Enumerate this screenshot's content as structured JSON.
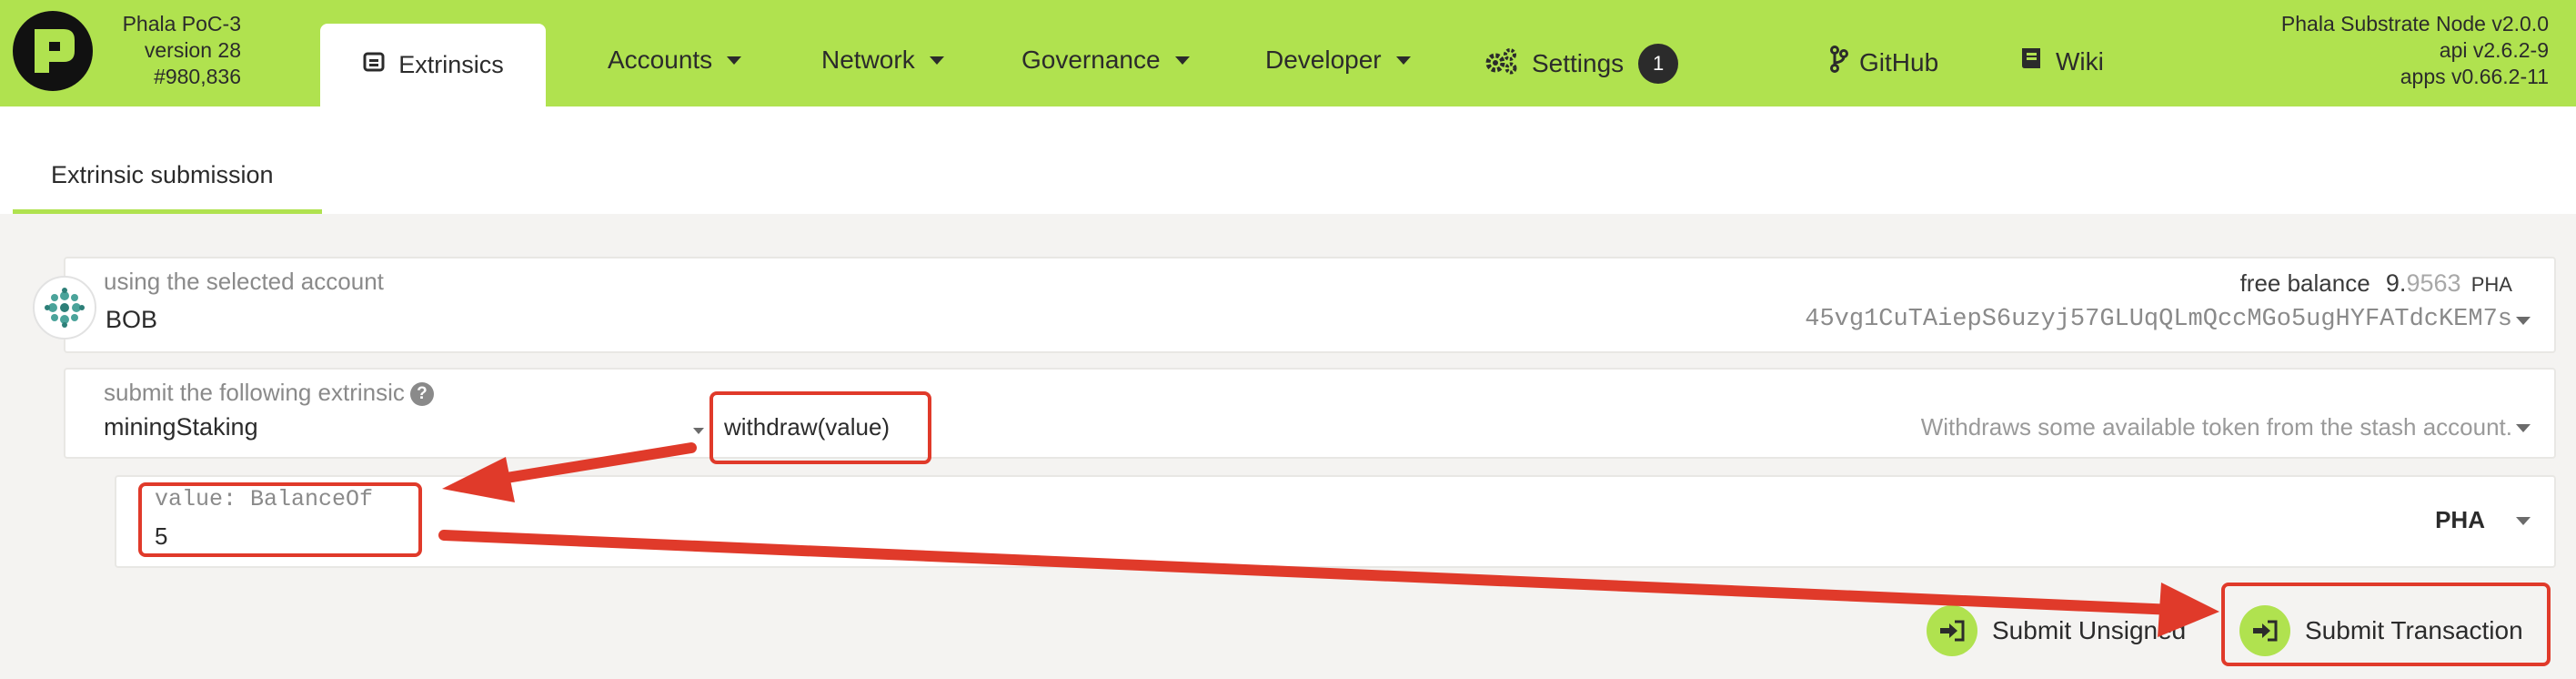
{
  "chain": {
    "name": "Phala PoC-3",
    "version": "version 28",
    "block": "#980,836"
  },
  "tabs": {
    "active": "Extrinsics"
  },
  "nav": [
    {
      "label": "Accounts"
    },
    {
      "label": "Network"
    },
    {
      "label": "Governance"
    },
    {
      "label": "Developer"
    },
    {
      "label": "Settings",
      "badge": "1"
    },
    {
      "label": "GitHub"
    },
    {
      "label": "Wiki"
    }
  ],
  "node": {
    "name": "Phala Substrate Node v2.0.0",
    "api": "api v2.6.2-9",
    "apps": "apps v0.66.2-11"
  },
  "subnav": {
    "tab": "Extrinsic submission"
  },
  "account": {
    "label": "using the selected account",
    "name": "BOB",
    "balance_label": "free balance",
    "balance_int": "9.",
    "balance_dec": "9563",
    "balance_unit": "PHA",
    "address": "45vg1CuTAiepS6uzyj57GLUqQLmQccMGo5ugHYFATdcKEM7s"
  },
  "extrinsic": {
    "label": "submit the following extrinsic",
    "help": "?",
    "module": "miningStaking",
    "method": "withdraw(value)",
    "description": "Withdraws some available token from the stash account."
  },
  "param": {
    "label": "value: BalanceOf",
    "value": "5",
    "unit": "PHA"
  },
  "actions": {
    "unsigned": "Submit Unsigned",
    "submit": "Submit Transaction"
  },
  "colors": {
    "accent": "#b0e24f",
    "annotation": "#e03a2a",
    "text": "#2b2b2b"
  }
}
